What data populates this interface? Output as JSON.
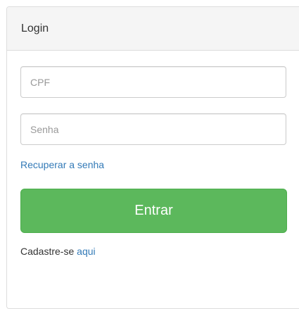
{
  "panel": {
    "title": "Login"
  },
  "form": {
    "cpf_placeholder": "CPF",
    "password_placeholder": "Senha",
    "recover_link": "Recuperar a senha",
    "submit_label": "Entrar",
    "signup_text": "Cadastre-se",
    "signup_link": "aqui"
  },
  "colors": {
    "primary_button": "#5cb85c",
    "link": "#337ab7",
    "heading_bg": "#f5f5f5"
  }
}
